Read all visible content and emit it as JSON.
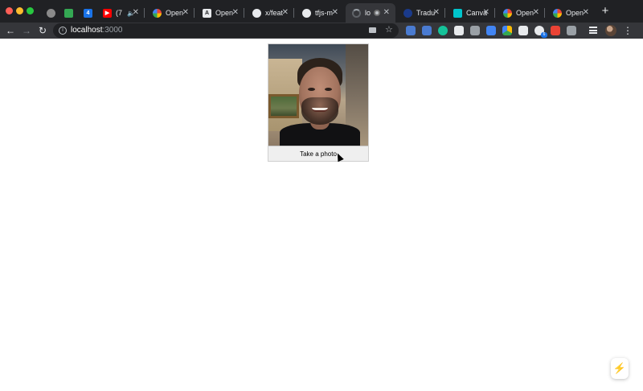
{
  "colors": {
    "tabstrip_bg": "#202124",
    "toolbar_bg": "#35363a",
    "page_bg": "#ffffff",
    "button_bg": "#efefef"
  },
  "tabs": [
    {
      "title": "",
      "icon": "circle-icon",
      "color": "#8a8a8a"
    },
    {
      "title": "",
      "icon": "tag-icon",
      "color": "#34a853"
    },
    {
      "title": "",
      "icon": "calendar-icon",
      "color": "#1a73e8"
    },
    {
      "title": "(7",
      "icon": "youtube-icon",
      "color": "#ff0000",
      "audio_icon": "speaker-icon"
    },
    {
      "title": "Open",
      "icon": "openai-icon",
      "color": "#e8453c"
    },
    {
      "title": "Open",
      "icon": "triangle-a-icon",
      "color": "#e8eaed"
    },
    {
      "title": "x/feat",
      "icon": "github-icon",
      "color": "#e8eaed"
    },
    {
      "title": "tfjs-m",
      "icon": "github-icon",
      "color": "#e8eaed"
    },
    {
      "title": "lo",
      "icon": "loading-icon",
      "color": "#5f6368",
      "active": true,
      "record_icon": "record-icon"
    },
    {
      "title": "Tradu",
      "icon": "translate-icon",
      "color": "#1a3a8a"
    },
    {
      "title": "Canva",
      "icon": "canva-icon",
      "color": "#00c4cc"
    },
    {
      "title": "Open",
      "icon": "openai-icon",
      "color": "#e8453c"
    },
    {
      "title": "Open",
      "icon": "openai-icon",
      "color": "#e8453c"
    }
  ],
  "toolbar": {
    "url_host": "localhost",
    "url_port": ":3000",
    "extensions": [
      {
        "icon": "pen-icon",
        "color": "#4a7bd1"
      },
      {
        "icon": "key-icon",
        "color": "#4a7bd1"
      },
      {
        "icon": "grammarly-icon",
        "color": "#15c39a"
      },
      {
        "icon": "notion-icon",
        "color": "#e8eaed"
      },
      {
        "icon": "camera-icon",
        "color": "#9aa0a6"
      },
      {
        "icon": "triangle-icon",
        "color": "#4285f4"
      },
      {
        "icon": "drive-icon",
        "color": "#fbbc04"
      },
      {
        "icon": "shield-icon",
        "color": "#e8eaed"
      },
      {
        "icon": "github-ext-icon",
        "color": "#e8eaed"
      },
      {
        "icon": "extension-icon",
        "color": "#ea4335"
      },
      {
        "icon": "bookmark-icon",
        "color": "#9aa0a6"
      },
      {
        "icon": "person-icon",
        "color": "#4285f4"
      }
    ],
    "badge": "6"
  },
  "page": {
    "button_label": "Take a photo",
    "bolt_icon": "lightning-icon"
  }
}
